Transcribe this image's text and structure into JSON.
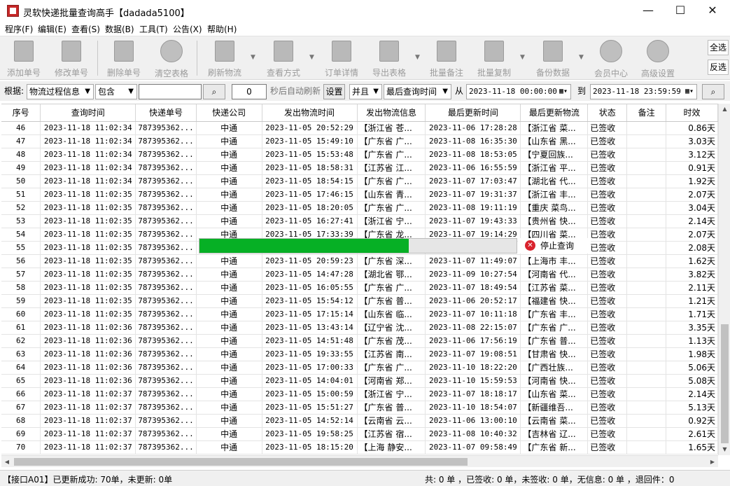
{
  "window": {
    "title": "灵软快递批量查询高手【dadada5100】"
  },
  "menu": [
    "程序(F)",
    "编辑(E)",
    "查看(S)",
    "数据(B)",
    "工具(T)",
    "公告(X)",
    "帮助(H)"
  ],
  "toolbar": {
    "add": "添加单号",
    "edit": "修改单号",
    "delete": "删除单号",
    "clear": "清空表格",
    "refresh": "刷新物流",
    "view": "查看方式",
    "detail": "订单详情",
    "export": "导出表格",
    "batch_note": "批量备注",
    "batch_copy": "批量复制",
    "backup": "备份数据",
    "member": "会员中心",
    "advanced": "高级设置",
    "select_all": "全选",
    "invert": "反选"
  },
  "filter": {
    "by_label": "根据:",
    "field": "物流过程信息",
    "match": "包含",
    "keyword": "",
    "interval": "0",
    "interval_label": "秒后自动刷新",
    "settings": "设置",
    "logic": "并且",
    "time_field": "最后查询时间",
    "from_label": "从",
    "from_value": "2023-11-18 00:00:00",
    "to_label": "到",
    "to_value": "2023-11-18 23:59:59"
  },
  "table": {
    "columns": [
      "序号",
      "查询时间",
      "快递单号",
      "快递公司",
      "发出物流时间",
      "发出物流信息",
      "最后更新时间",
      "最后更新物流",
      "状态",
      "备注",
      "时效"
    ],
    "rows": [
      [
        "46",
        "2023-11-18 11:02:34",
        "787395362...",
        "中通",
        "2023-11-05 20:52:29",
        "【浙江省 苍...",
        "2023-11-06 17:28:28",
        "【浙江省 菜...",
        "已签收",
        "",
        "0.86天"
      ],
      [
        "47",
        "2023-11-18 11:02:34",
        "787395362...",
        "中通",
        "2023-11-05 15:49:10",
        "【广东省 广...",
        "2023-11-08 16:35:30",
        "【山东省 黑...",
        "已签收",
        "",
        "3.03天"
      ],
      [
        "48",
        "2023-11-18 11:02:34",
        "787395362...",
        "中通",
        "2023-11-05 15:53:48",
        "【广东省 广...",
        "2023-11-08 18:53:05",
        "【宁夏回族...",
        "已签收",
        "",
        "3.12天"
      ],
      [
        "49",
        "2023-11-18 11:02:34",
        "787395362...",
        "中通",
        "2023-11-05 18:58:31",
        "【江苏省 江...",
        "2023-11-06 16:55:59",
        "【浙江省 平...",
        "已签收",
        "",
        "0.91天"
      ],
      [
        "50",
        "2023-11-18 11:02:34",
        "787395362...",
        "中通",
        "2023-11-05 18:54:15",
        "【广东省 广...",
        "2023-11-07 17:03:47",
        "【湖北省 代...",
        "已签收",
        "",
        "1.92天"
      ],
      [
        "51",
        "2023-11-18 11:02:35",
        "787395362...",
        "中通",
        "2023-11-05 17:46:15",
        "【山东省 青...",
        "2023-11-07 19:31:37",
        "【浙江省 丰...",
        "已签收",
        "",
        "2.07天"
      ],
      [
        "52",
        "2023-11-18 11:02:35",
        "787395362...",
        "中通",
        "2023-11-05 18:20:05",
        "【广东省 广...",
        "2023-11-08 19:11:19",
        "【重庆 菜鸟...",
        "已签收",
        "",
        "3.04天"
      ],
      [
        "53",
        "2023-11-18 11:02:35",
        "787395362...",
        "中通",
        "2023-11-05 16:27:41",
        "【浙江省 宁...",
        "2023-11-07 19:43:33",
        "【贵州省 快...",
        "已签收",
        "",
        "2.14天"
      ],
      [
        "54",
        "2023-11-18 11:02:35",
        "787395362...",
        "中通",
        "2023-11-05 17:33:39",
        "【广东省 龙...",
        "2023-11-07 19:14:29",
        "【四川省 菜...",
        "已签收",
        "",
        "2.07天"
      ],
      [
        "55",
        "2023-11-18 11:02:35",
        "787395362...",
        "",
        "",
        "",
        "",
        "",
        "已签收",
        "",
        "2.08天"
      ],
      [
        "56",
        "2023-11-18 11:02:35",
        "787395362...",
        "中通",
        "2023-11-05 20:59:23",
        "【广东省 深...",
        "2023-11-07 11:49:07",
        "【上海市 丰...",
        "已签收",
        "",
        "1.62天"
      ],
      [
        "57",
        "2023-11-18 11:02:35",
        "787395362...",
        "中通",
        "2023-11-05 14:47:28",
        "【湖北省 鄂...",
        "2023-11-09 10:27:54",
        "【河南省 代...",
        "已签收",
        "",
        "3.82天"
      ],
      [
        "58",
        "2023-11-18 11:02:35",
        "787395362...",
        "中通",
        "2023-11-05 16:05:55",
        "【广东省 广...",
        "2023-11-07 18:49:54",
        "【江苏省 菜...",
        "已签收",
        "",
        "2.11天"
      ],
      [
        "59",
        "2023-11-18 11:02:35",
        "787395362...",
        "中通",
        "2023-11-05 15:54:12",
        "【广东省 普...",
        "2023-11-06 20:52:17",
        "【福建省 快...",
        "已签收",
        "",
        "1.21天"
      ],
      [
        "60",
        "2023-11-18 11:02:35",
        "787395362...",
        "中通",
        "2023-11-05 17:15:14",
        "【山东省 临...",
        "2023-11-07 10:11:18",
        "【广东省 丰...",
        "已签收",
        "",
        "1.71天"
      ],
      [
        "61",
        "2023-11-18 11:02:36",
        "787395362...",
        "中通",
        "2023-11-05 13:43:14",
        "【辽宁省 沈...",
        "2023-11-08 22:15:07",
        "【广东省 广...",
        "已签收",
        "",
        "3.35天"
      ],
      [
        "62",
        "2023-11-18 11:02:36",
        "787395362...",
        "中通",
        "2023-11-05 14:51:48",
        "【广东省 茂...",
        "2023-11-06 17:56:19",
        "【广东省 普...",
        "已签收",
        "",
        "1.13天"
      ],
      [
        "63",
        "2023-11-18 11:02:36",
        "787395362...",
        "中通",
        "2023-11-05 19:33:55",
        "【江苏省 南...",
        "2023-11-07 19:08:51",
        "【甘肃省 快...",
        "已签收",
        "",
        "1.98天"
      ],
      [
        "64",
        "2023-11-18 11:02:36",
        "787395362...",
        "中通",
        "2023-11-05 17:00:33",
        "【广东省 广...",
        "2023-11-10 18:22:20",
        "【广西壮族...",
        "已签收",
        "",
        "5.06天"
      ],
      [
        "65",
        "2023-11-18 11:02:36",
        "787395362...",
        "中通",
        "2023-11-05 14:04:01",
        "【河南省 郑...",
        "2023-11-10 15:59:53",
        "【河南省 快...",
        "已签收",
        "",
        "5.08天"
      ],
      [
        "66",
        "2023-11-18 11:02:37",
        "787395362...",
        "中通",
        "2023-11-05 15:00:59",
        "【浙江省 宁...",
        "2023-11-07 18:18:17",
        "【山东省 菜...",
        "已签收",
        "",
        "2.14天"
      ],
      [
        "67",
        "2023-11-18 11:02:37",
        "787395362...",
        "中通",
        "2023-11-05 15:51:27",
        "【广东省 普...",
        "2023-11-10 18:54:07",
        "【新疆维吾...",
        "已签收",
        "",
        "5.13天"
      ],
      [
        "68",
        "2023-11-18 11:02:37",
        "787395362...",
        "中通",
        "2023-11-05 14:52:14",
        "【云南省 云...",
        "2023-11-06 13:00:10",
        "【云南省 菜...",
        "已签收",
        "",
        "0.92天"
      ],
      [
        "69",
        "2023-11-18 11:02:37",
        "787395362...",
        "中通",
        "2023-11-05 19:58:25",
        "【江苏省 宿...",
        "2023-11-08 10:40:32",
        "【吉林省 辽...",
        "已签收",
        "",
        "2.61天"
      ],
      [
        "70",
        "2023-11-18 11:02:37",
        "787395362...",
        "中通",
        "2023-11-05 18:15:20",
        "【上海 静安...",
        "2023-11-07 09:58:49",
        "【广东省 新...",
        "已签收",
        "",
        "1.65天"
      ]
    ]
  },
  "progress": {
    "fraction": 0.66,
    "color": "#06b025",
    "stop_label": "停止查询"
  },
  "status": {
    "left": "【接口A01】已更新成功: 70单，未更新: 0单",
    "right": "共: 0 单 ，已签收:  0 单，未签收:  0 单，无信息: 0 单 ，退回件：0"
  }
}
